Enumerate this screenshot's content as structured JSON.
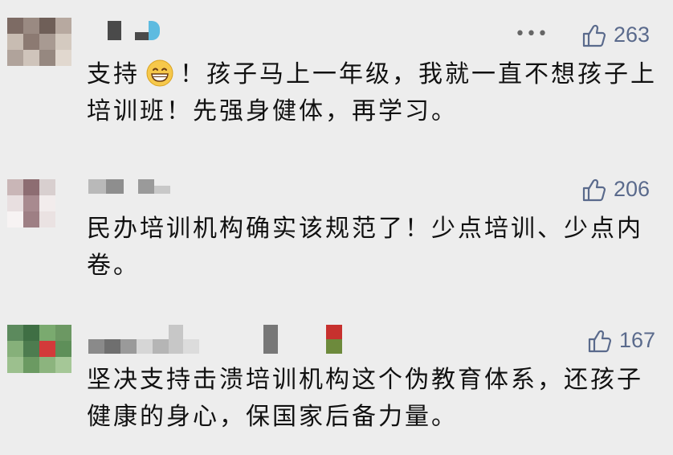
{
  "comments": [
    {
      "more_icon": "more-dots-icon",
      "like_icon": "thumbs-up-icon",
      "like_count": "263",
      "text_before_emoji": "支持",
      "emoji": "grinning-face-icon",
      "text_after_emoji": "！孩子马上一年级，我就一直不想孩子上培训班！先强身健体，再学习。"
    },
    {
      "like_icon": "thumbs-up-icon",
      "like_count": "206",
      "text": "民办培训机构确实该规范了！少点培训、少点内卷。"
    },
    {
      "like_icon": "thumbs-up-icon",
      "like_count": "167",
      "text": "坚决支持击溃培训机构这个伪教育体系，还孩子健康的身心，保国家后备力量。"
    }
  ],
  "colors": {
    "background": "#ededed",
    "like": "#5a6a8c",
    "text": "#111111"
  }
}
